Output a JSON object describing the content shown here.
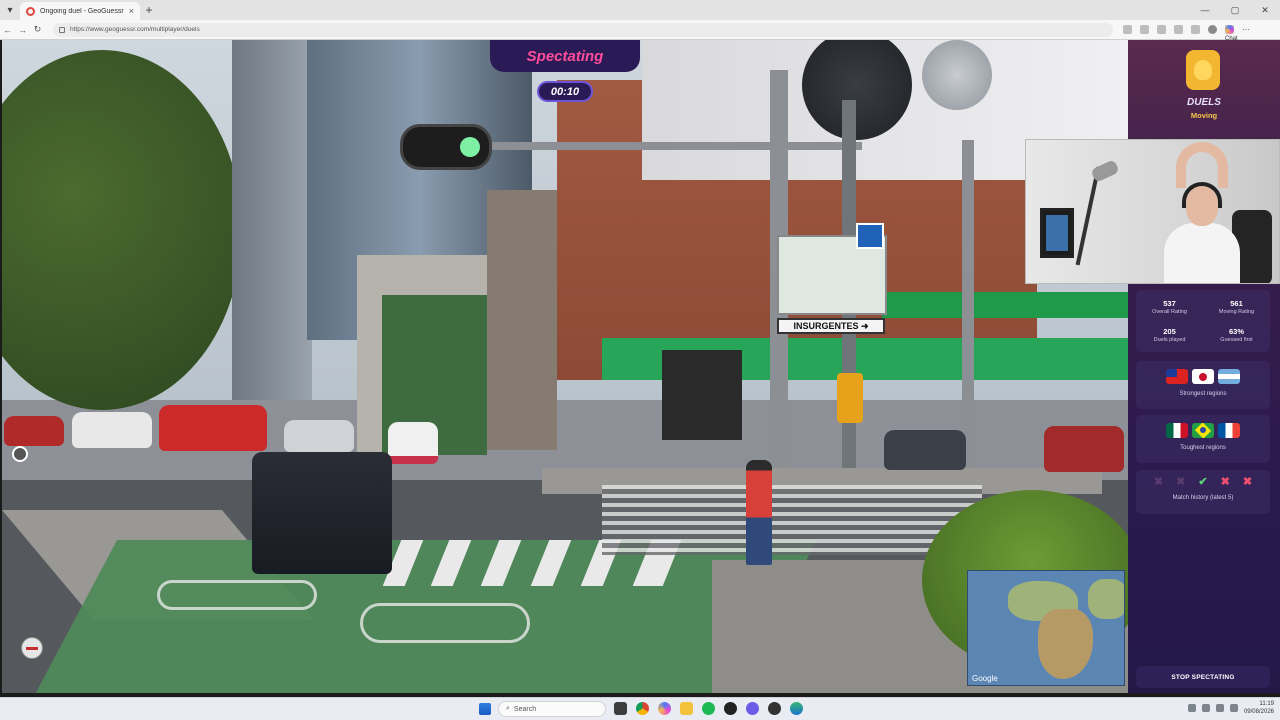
{
  "browser": {
    "tab_title": "Ongoing duel - GeoGuessr",
    "url": "https://www.geoguessr.com/multiplayer/duels",
    "new_tab": "+",
    "chat_label": "Chat"
  },
  "game": {
    "mode_banner": "Spectating",
    "timer": "00:10",
    "map_logo": "Google"
  },
  "sidebar": {
    "title": "DUELS",
    "subtitle": "Moving",
    "stats": [
      {
        "value": "537",
        "label": "Overall Rating"
      },
      {
        "value": "561",
        "label": "Moving Rating"
      },
      {
        "value": "205",
        "label": "Duels played"
      },
      {
        "value": "63%",
        "label": "Guessed first"
      }
    ],
    "strongest_label": "Strongest regions",
    "strongest_flags": [
      "taiwan-flag",
      "japan-flag",
      "argentina-flag"
    ],
    "toughest_label": "Toughest regions",
    "toughest_flags": [
      "mexico-flag",
      "brazil-flag",
      "france-flag"
    ],
    "history_label": "Match history (latest 5)",
    "history": [
      {
        "mark": "✖",
        "result": "loss",
        "color": "#5a3b6e"
      },
      {
        "mark": "✖",
        "result": "loss",
        "color": "#5a3b6e"
      },
      {
        "mark": "✔",
        "result": "win",
        "color": "#5fd07a"
      },
      {
        "mark": "✖",
        "result": "loss",
        "color": "#f0506e"
      },
      {
        "mark": "✖",
        "result": "loss",
        "color": "#f0506e"
      }
    ],
    "stop_button": "STOP SPECTATING"
  },
  "taskbar": {
    "search_placeholder": "Search",
    "time": "11:19",
    "date": "09/08/2026"
  },
  "colors": {
    "accent_pink": "#ff4d9a",
    "panel_purple": "#2a1b57",
    "gold": "#f7c948"
  }
}
